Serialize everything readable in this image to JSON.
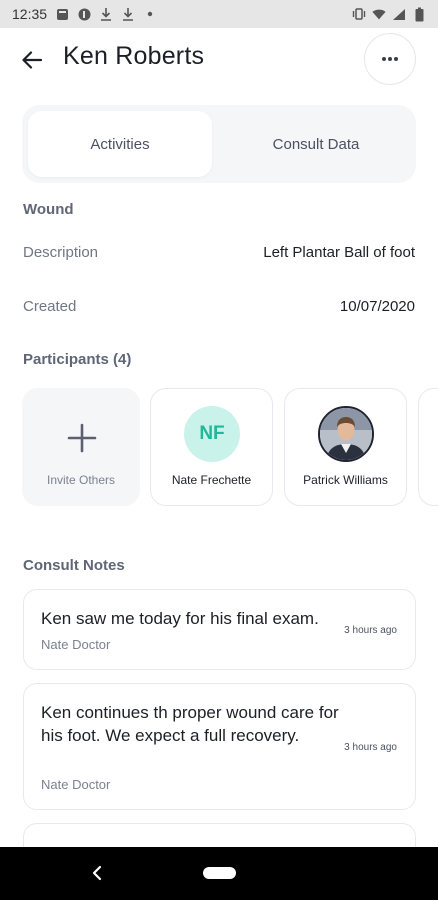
{
  "status_bar": {
    "time": "12:35"
  },
  "header": {
    "title": "Ken Roberts"
  },
  "tabs": [
    {
      "label": "Activities",
      "active": true
    },
    {
      "label": "Consult Data",
      "active": false
    }
  ],
  "wound": {
    "section_label": "Wound",
    "description_label": "Description",
    "description_value": "Left Plantar Ball of foot",
    "created_label": "Created",
    "created_value": "10/07/2020"
  },
  "participants": {
    "section_label": "Participants (4)",
    "invite_label": "Invite Others",
    "items": [
      {
        "name": "Nate Frechette",
        "initials": "NF",
        "avatar_color": "#c9f2ea",
        "initials_color": "#1fb89a"
      },
      {
        "name": "Patrick Williams",
        "initials": ""
      }
    ]
  },
  "consult_notes": {
    "section_label": "Consult Notes",
    "notes": [
      {
        "text": "Ken saw me today for his final exam.",
        "author": "Nate Doctor",
        "time": "3 hours ago"
      },
      {
        "text": "Ken continues th proper wound care for his foot. We expect a full recovery.",
        "author": "Nate Doctor",
        "time": "3 hours ago"
      }
    ]
  }
}
